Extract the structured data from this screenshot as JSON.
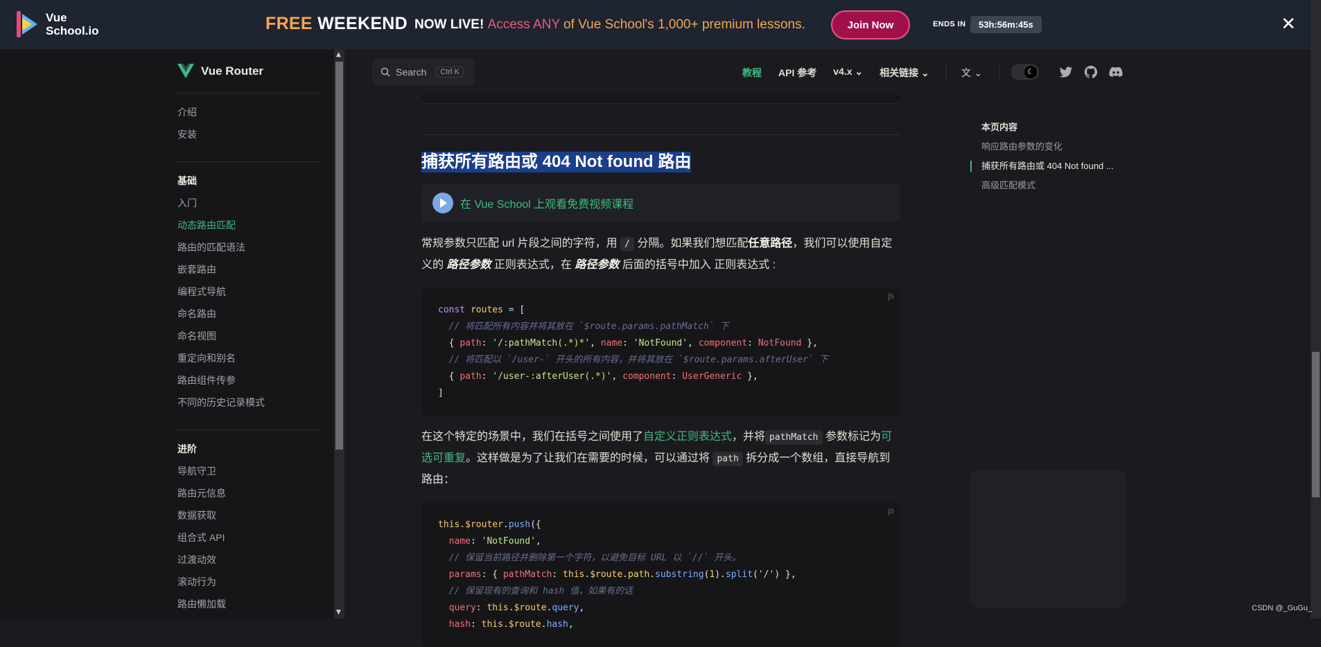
{
  "banner": {
    "logo_text_1": "Vue",
    "logo_text_2": "School.io",
    "free": "FREE",
    "weekend": "WEEKEND",
    "now_live": "NOW LIVE!",
    "access_1": "Access ",
    "access_any": "ANY",
    "access_2": " of Vue School's 1,000+ premium lessons.",
    "join_label": "Join Now",
    "ends_label": "ENDS IN",
    "timer": "53h:56m:45s",
    "close_glyph": "✕"
  },
  "sidebar": {
    "brand": "Vue Router",
    "intro": [
      "介绍",
      "安装"
    ],
    "sections": [
      {
        "title": "基础",
        "items": [
          "入门",
          "动态路由匹配",
          "路由的匹配语法",
          "嵌套路由",
          "编程式导航",
          "命名路由",
          "命名视图",
          "重定向和别名",
          "路由组件传参",
          "不同的历史记录模式"
        ]
      },
      {
        "title": "进阶",
        "items": [
          "导航守卫",
          "路由元信息",
          "数据获取",
          "组合式 API",
          "过渡动效",
          "滚动行为",
          "路由懒加载"
        ]
      }
    ],
    "active_item": "动态路由匹配"
  },
  "topnav": {
    "search_label": "Search",
    "search_kbd": "Ctrl K",
    "links": [
      "教程",
      "API 参考",
      "v4.x ⌄",
      "相关链接 ⌄"
    ],
    "lang_glyph": "文 ⌄"
  },
  "content": {
    "heading": "捕获所有路由或 404 Not found 路由",
    "vs_link": "在 Vue School 上观看免费视频课程",
    "p1_a": "常规参数只匹配 url 片段之间的字符，用 ",
    "p1_code": "/",
    "p1_b": " 分隔。如果我们想匹配",
    "p1_bold": "任意路径",
    "p1_c": "，我们可以使用自定义的 ",
    "p1_em1": "路径参数",
    "p1_d": " 正则表达式，在 ",
    "p1_em2": "路径参数",
    "p1_e": " 后面的括号中加入 正则表达式 :",
    "code1_lang": "js",
    "p2_a": "在这个特定的场景中，我们在括号之间使用了",
    "p2_link1": "自定义正则表达式",
    "p2_b": "，并将",
    "p2_code1": "pathMatch",
    "p2_c": " 参数标记为",
    "p2_link2": "可选可重复",
    "p2_d": "。这样做是为了让我们在需要的时候，可以通过将 ",
    "p2_code2": "path",
    "p2_e": " 拆分成一个数组，直接导航到路由：",
    "code2_lang": "js"
  },
  "toc": {
    "title": "本页内容",
    "items": [
      "响应路由参数的变化",
      "捕获所有路由或 404 Not found ...",
      "高级匹配模式"
    ]
  },
  "watermark": "CSDN @_GuGu_"
}
